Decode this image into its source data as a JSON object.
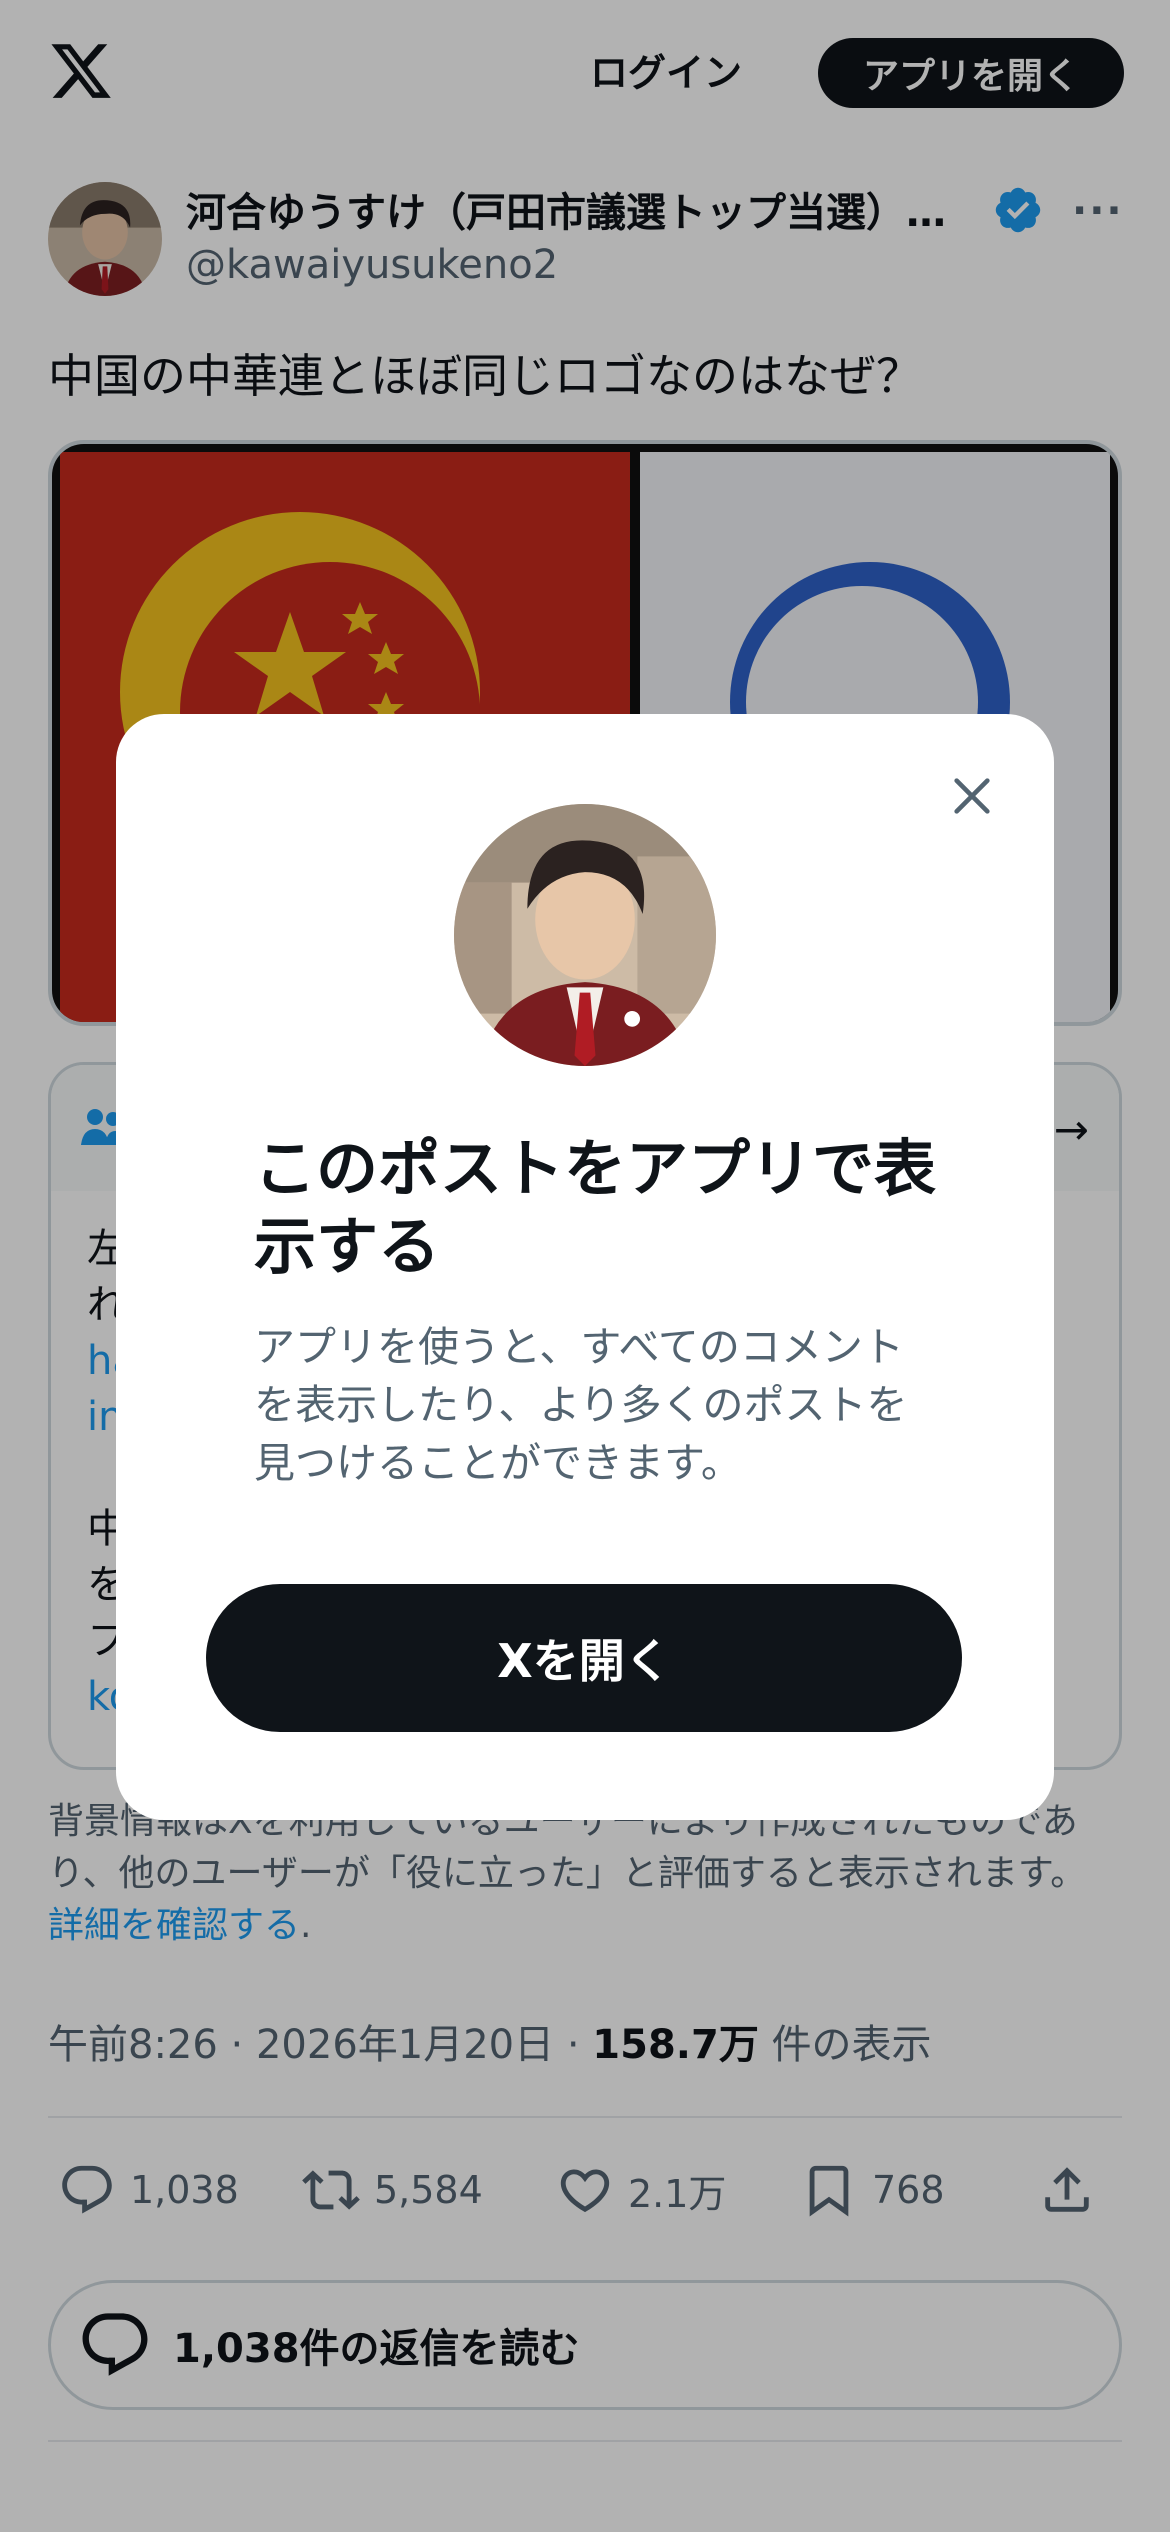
{
  "header": {
    "logo_icon": "x-logo-icon",
    "login_label": "ログイン",
    "open_app_label": "アプリを開く"
  },
  "post": {
    "author_name": "河合ゆうすけ（戸田市議選トップ当選）…",
    "handle": "@kawaiyusukeno2",
    "verified_icon": "verified-badge-icon",
    "more_icon": "more-options-icon",
    "text": "中国の中華連とほぼ同じロゴなのはなぜ？",
    "notes": {
      "icon": "community-notes-icon",
      "arrow_icon": "arrow-right-icon",
      "lines": [
        "左",
        "れ",
        "ha",
        "in",
        "",
        "中",
        "を",
        "フ",
        "ko"
      ]
    },
    "context_note": "背景情報はXを利用しているユーザーにより作成されたものであり、他のユーザーが「役に立った」と評価すると表示されます。",
    "context_link": "詳細を確認する",
    "context_tail": ".",
    "meta": {
      "time": "午前8:26",
      "sep1": " · ",
      "date": "2026年1月20日",
      "sep2": " · ",
      "views": "158.7万",
      "views_label": " 件の表示"
    },
    "actions": {
      "reply_count": "1,038",
      "repost_count": "5,584",
      "like_count": "2.1万",
      "bookmark_count": "768"
    },
    "read_replies_label": "1,038件の返信を読む"
  },
  "modal": {
    "close_icon": "close-icon",
    "title": "このポストをアプリで表示する",
    "body": "アプリを使うと、すべてのコメントを表示したり、より多くのポストを見つけることができます。",
    "cta_label": "Xを開く"
  },
  "colors": {
    "text": "#0f1419",
    "secondary": "#536471",
    "link": "#1d9bf0",
    "verified": "#1d9bf0",
    "dark_button": "#0f1419"
  }
}
